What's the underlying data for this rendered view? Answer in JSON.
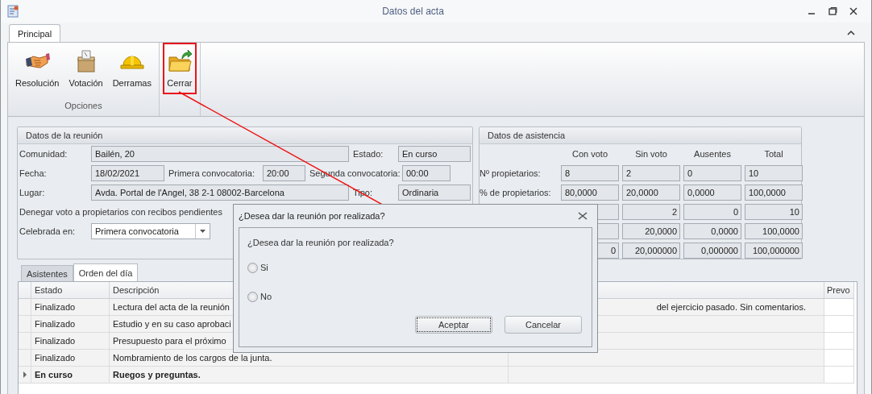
{
  "window": {
    "title": "Datos del acta"
  },
  "ribbon": {
    "tabs": [
      {
        "label": "Principal",
        "selected": true
      }
    ],
    "groups": [
      {
        "caption": "Opciones",
        "buttons": [
          {
            "label": "Resolución",
            "kind": "handshake",
            "highlighted": false
          },
          {
            "label": "Votación",
            "kind": "ballot",
            "highlighted": false
          },
          {
            "label": "Derramas",
            "kind": "helmet",
            "highlighted": false
          }
        ]
      },
      {
        "buttons": [
          {
            "label": "Cerrar",
            "kind": "folder",
            "highlighted": true
          }
        ]
      }
    ]
  },
  "meeting": {
    "title": "Datos de la reunión",
    "community": {
      "label": "Comunidad:",
      "value": "Bailén, 20"
    },
    "state": {
      "label": "Estado:",
      "value": "En curso"
    },
    "date": {
      "label": "Fecha:",
      "value": "18/02/2021"
    },
    "first_call": {
      "label": "Primera convocatoria:",
      "value": "20:00"
    },
    "second_call": {
      "label": "Segunda convocatoria:",
      "value": "00:00"
    },
    "place": {
      "label": "Lugar:",
      "value": "Avda. Portal de l'Angel, 38 2-1 08002-Barcelona"
    },
    "type": {
      "label": "Tipo:",
      "value": "Ordinaria"
    },
    "deny_vote": {
      "label": "Denegar voto a propietarios con recibos pendientes"
    },
    "held_in": {
      "label": "Celebrada en:",
      "value": "Primera convocatoria"
    }
  },
  "attendance": {
    "title": "Datos de asistencia",
    "columns": [
      "Con voto",
      "Sin voto",
      "Ausentes",
      "Total"
    ],
    "rows": [
      {
        "label": "Nº propietarios:",
        "values": [
          "8",
          "2",
          "0",
          "10"
        ]
      },
      {
        "label": "% de propietarios:",
        "values": [
          "80,0000",
          "20,0000",
          "0,0000",
          "100,0000"
        ]
      },
      {
        "values": [
          "2",
          "0",
          "10"
        ]
      },
      {
        "values": [
          "20,0000",
          "0,0000",
          "100,0000"
        ]
      },
      {
        "values": [
          "0",
          "20,000000",
          "0,000000",
          "100,000000"
        ]
      }
    ]
  },
  "bottom_tabs": [
    {
      "label": "Asistentes",
      "selected": false
    },
    {
      "label": "Orden del día",
      "selected": true
    }
  ],
  "agenda": {
    "columns": [
      "Estado",
      "Descripción",
      "Prevo"
    ],
    "rows": [
      {
        "status": "Finalizado",
        "description": "Lectura del acta de la reunión",
        "description_end": "del ejercicio pasado. Sin comentarios.",
        "current": false
      },
      {
        "status": "Finalizado",
        "description": "Estudio y en su caso aprobaci",
        "current": false
      },
      {
        "status": "Finalizado",
        "description": "Presupuesto para el próximo",
        "current": false
      },
      {
        "status": "Finalizado",
        "description": "Nombramiento de los cargos de la junta.",
        "current": false
      },
      {
        "status": "En curso",
        "description": "Ruegos y preguntas.",
        "current": true
      }
    ]
  },
  "dialog": {
    "title": "¿Desea dar la reunión por realizada?",
    "question": "¿Desea dar la reunión por realizada?",
    "options": [
      {
        "label": "Si",
        "selected": false
      },
      {
        "label": "No",
        "selected": false
      }
    ],
    "buttons": [
      {
        "label": "Aceptar",
        "focused": true
      },
      {
        "label": "Cancelar",
        "focused": false
      }
    ]
  }
}
